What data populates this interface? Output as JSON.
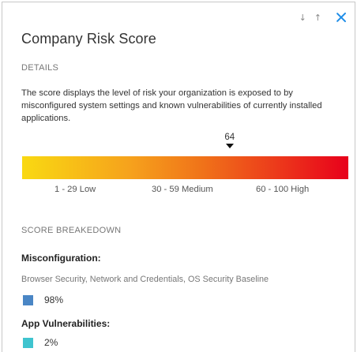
{
  "topbar": {
    "sort_down_icon": "↓",
    "sort_up_icon": "↑",
    "close_icon": "close-icon",
    "accent_color": "#1e8de8"
  },
  "title": "Company Risk Score",
  "details": {
    "heading": "DETAILS",
    "description": "The score displays the level of risk your organization is exposed to by misconfigured system settings and known vulnerabilities of currently installed applications."
  },
  "score": {
    "value": "64",
    "scale_min": 1,
    "scale_max": 100,
    "ranges": [
      {
        "label": "1 - 29 Low"
      },
      {
        "label": "30 - 59 Medium"
      },
      {
        "label": "60 - 100 High"
      }
    ]
  },
  "breakdown": {
    "heading": "SCORE BREAKEDOWN",
    "items": [
      {
        "label": "Misconfiguration:",
        "sublabel": "Browser Security, Network and Credentials, OS Security Baseline",
        "percent": "98%",
        "color": "#4a86c5"
      },
      {
        "label": "App Vulnerabilities:",
        "sublabel": "",
        "percent": "2%",
        "color": "#3fc4cf"
      }
    ]
  }
}
